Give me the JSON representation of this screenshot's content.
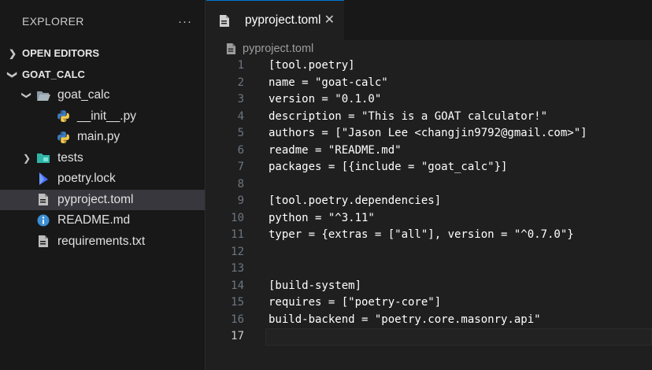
{
  "explorer": {
    "title": "EXPLORER",
    "more_label": "···",
    "open_editors_label": "OPEN EDITORS",
    "root_folder": "GOAT_CALC",
    "items": [
      {
        "label": "goat_calc",
        "type": "folder-open",
        "indent": 1
      },
      {
        "label": "__init__.py",
        "type": "python",
        "indent": 2
      },
      {
        "label": "main.py",
        "type": "python",
        "indent": 2
      },
      {
        "label": "tests",
        "type": "folder-closed",
        "indent": 1
      },
      {
        "label": "poetry.lock",
        "type": "poetry",
        "indent": 1
      },
      {
        "label": "pyproject.toml",
        "type": "file",
        "indent": 1,
        "selected": true
      },
      {
        "label": "README.md",
        "type": "info",
        "indent": 1
      },
      {
        "label": "requirements.txt",
        "type": "file",
        "indent": 1
      }
    ]
  },
  "tab": {
    "label": "pyproject.toml",
    "close": "✕"
  },
  "breadcrumb": {
    "label": "pyproject.toml"
  },
  "code": {
    "current_line": 17,
    "lines": [
      "[tool.poetry]",
      "name = \"goat-calc\"",
      "version = \"0.1.0\"",
      "description = \"This is a GOAT calculator!\"",
      "authors = [\"Jason Lee <changjin9792@gmail.com>\"]",
      "readme = \"README.md\"",
      "packages = [{include = \"goat_calc\"}]",
      "",
      "[tool.poetry.dependencies]",
      "python = \"^3.11\"",
      "typer = {extras = [\"all\"], version = \"^0.7.0\"}",
      "",
      "",
      "[build-system]",
      "requires = [\"poetry-core\"]",
      "build-backend = \"poetry.core.masonry.api\"",
      ""
    ]
  },
  "colors": {
    "accent": "#0078d4",
    "python_blue": "#3b7bbf",
    "python_yellow": "#f2c94c",
    "folder": "#8a9aa6",
    "tests_folder": "#2fb5a8",
    "info": "#3c8fd6"
  }
}
